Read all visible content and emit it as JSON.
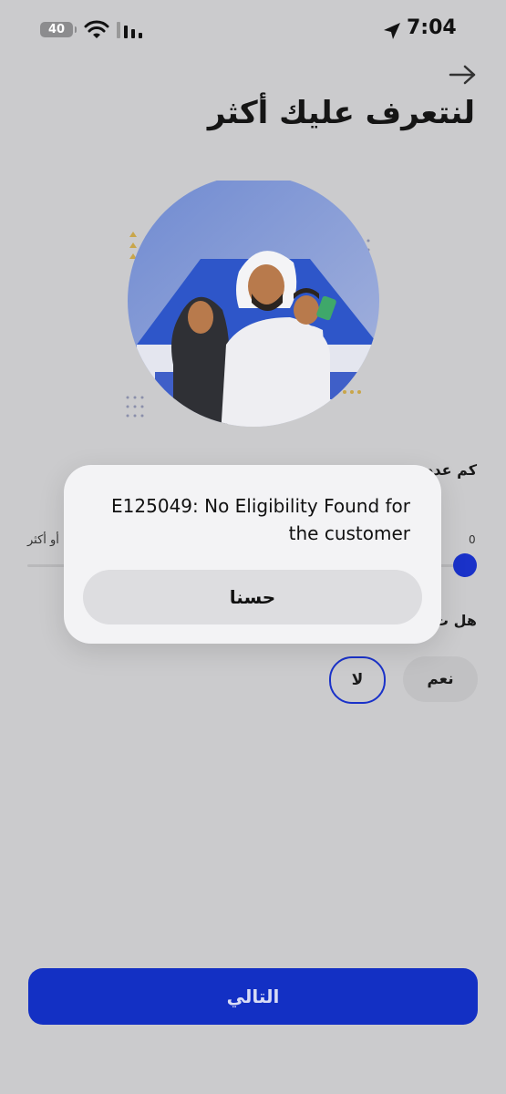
{
  "status_bar": {
    "battery": "40",
    "time": "7:04"
  },
  "header": {
    "title": "لنتعرف عليك أكثر"
  },
  "form": {
    "question_1": "كم عدد",
    "slider_min": "0",
    "slider_max": "أو أكثر",
    "slider_value_fraction": 1.0,
    "question_2": "هل ت",
    "options": [
      "نعم",
      "لا"
    ],
    "selected_option": "لا"
  },
  "alert": {
    "message": "E125049: No Eligibility Found for the customer",
    "button_label": "حسنا"
  },
  "footer": {
    "next_label": "التالي"
  },
  "colors": {
    "primary": "#1330c4",
    "background": "#cbcbcd",
    "alert_background": "#f3f3f5"
  }
}
